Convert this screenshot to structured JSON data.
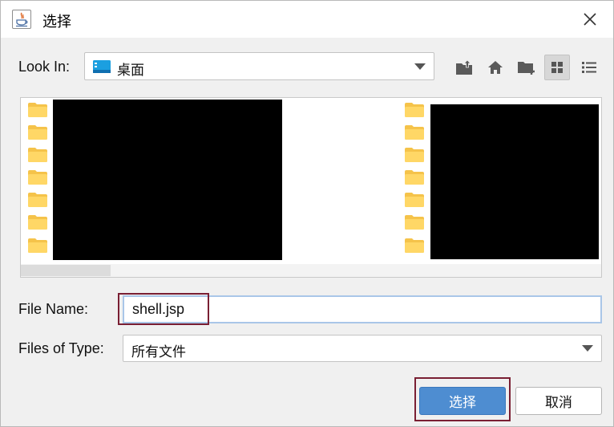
{
  "window": {
    "title": "选择",
    "close_icon": "close-icon"
  },
  "look_in": {
    "label": "Look In:",
    "value": "桌面",
    "icon": "desktop-folder-icon"
  },
  "toolbar": {
    "buttons": [
      {
        "name": "up-one-level-icon"
      },
      {
        "name": "home-icon"
      },
      {
        "name": "new-folder-icon"
      },
      {
        "name": "list-view-icon",
        "active": true
      },
      {
        "name": "details-view-icon"
      }
    ]
  },
  "file_name": {
    "label": "File Name:",
    "value": "shell.jsp"
  },
  "file_type": {
    "label": "Files of Type:",
    "value": "所有文件"
  },
  "buttons": {
    "approve_label": "选择",
    "cancel_label": "取消"
  },
  "colors": {
    "accent": "#4e8dd1",
    "highlight": "#7a1f33",
    "folder": "#f5c34a"
  }
}
